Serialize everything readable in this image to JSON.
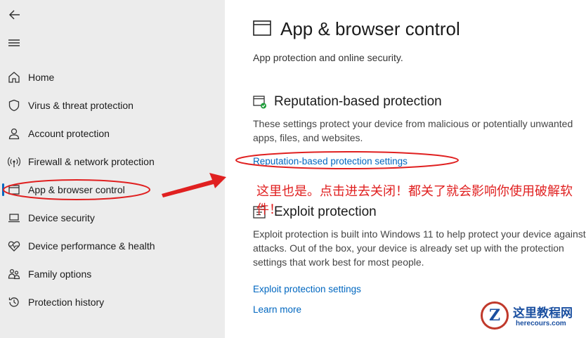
{
  "sidebar": {
    "items": [
      {
        "label": "Home",
        "icon": "home-icon"
      },
      {
        "label": "Virus & threat protection",
        "icon": "shield-icon"
      },
      {
        "label": "Account protection",
        "icon": "person-icon"
      },
      {
        "label": "Firewall & network protection",
        "icon": "wifi-icon"
      },
      {
        "label": "App & browser control",
        "icon": "app-window-icon",
        "active": true
      },
      {
        "label": "Device security",
        "icon": "laptop-icon"
      },
      {
        "label": "Device performance & health",
        "icon": "heart-pulse-icon"
      },
      {
        "label": "Family options",
        "icon": "family-icon"
      },
      {
        "label": "Protection history",
        "icon": "history-icon"
      }
    ]
  },
  "main": {
    "title": "App & browser control",
    "subtitle": "App protection and online security.",
    "reputation": {
      "title": "Reputation-based protection",
      "description": "These settings protect your device from malicious or potentially unwanted apps, files, and websites.",
      "link": "Reputation-based protection settings"
    },
    "exploit": {
      "title": "Exploit protection",
      "description": "Exploit protection is built into Windows 11 to help protect your device against attacks.  Out of the box, your device is already set up with the protection settings that work best for most people.",
      "link": "Exploit protection settings",
      "learn_more": "Learn more"
    }
  },
  "annotation": {
    "text": "这里也是。点击进去关闭！都关了就会影响你使用破解软件！",
    "color": "#e02020"
  },
  "watermark": {
    "letter": "Z",
    "title": "这里教程网",
    "url": "herecours.com"
  },
  "colors": {
    "accent": "#0067c0",
    "sidebar_bg": "#ececec",
    "annotation_red": "#e02020"
  }
}
